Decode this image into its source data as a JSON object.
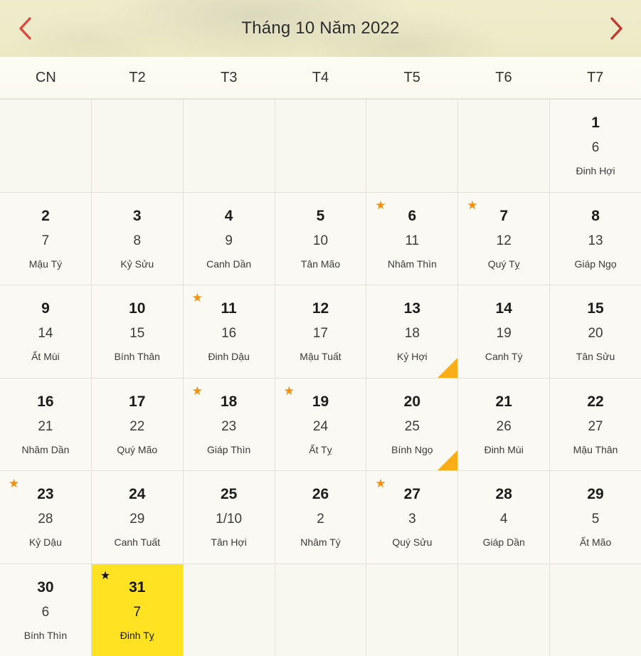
{
  "header": {
    "title": "Tháng 10 Năm 2022",
    "prev_label": "‹",
    "next_label": "›",
    "prev_icon": "chevron-left-icon",
    "next_icon": "chevron-right-icon",
    "accent_color": "#d94b42",
    "background_color": "#eeebc9"
  },
  "weekdays": [
    "CN",
    "T2",
    "T3",
    "T4",
    "T5",
    "T6",
    "T7"
  ],
  "legend": {
    "star_icon": "★",
    "star_color": "#f29011",
    "today_star_color": "#121212",
    "today_background": "#ffe323",
    "triangle_color": "#f9ad17"
  },
  "days": [
    {
      "solar": "",
      "lunar": "",
      "canchi": "",
      "blank": true
    },
    {
      "solar": "",
      "lunar": "",
      "canchi": "",
      "blank": true
    },
    {
      "solar": "",
      "lunar": "",
      "canchi": "",
      "blank": true
    },
    {
      "solar": "",
      "lunar": "",
      "canchi": "",
      "blank": true
    },
    {
      "solar": "",
      "lunar": "",
      "canchi": "",
      "blank": true
    },
    {
      "solar": "",
      "lunar": "",
      "canchi": "",
      "blank": true
    },
    {
      "solar": "1",
      "lunar": "6",
      "canchi": "Đinh Hợi"
    },
    {
      "solar": "2",
      "lunar": "7",
      "canchi": "Mậu Tý"
    },
    {
      "solar": "3",
      "lunar": "8",
      "canchi": "Kỷ Sửu"
    },
    {
      "solar": "4",
      "lunar": "9",
      "canchi": "Canh Dần"
    },
    {
      "solar": "5",
      "lunar": "10",
      "canchi": "Tân Mão"
    },
    {
      "solar": "6",
      "lunar": "11",
      "canchi": "Nhâm Thìn",
      "star": true
    },
    {
      "solar": "7",
      "lunar": "12",
      "canchi": "Quý Tỵ",
      "star": true
    },
    {
      "solar": "8",
      "lunar": "13",
      "canchi": "Giáp Ngọ"
    },
    {
      "solar": "9",
      "lunar": "14",
      "canchi": "Ất Mùi"
    },
    {
      "solar": "10",
      "lunar": "15",
      "canchi": "Bính Thân"
    },
    {
      "solar": "11",
      "lunar": "16",
      "canchi": "Đinh Dậu",
      "star": true
    },
    {
      "solar": "12",
      "lunar": "17",
      "canchi": "Mậu Tuất"
    },
    {
      "solar": "13",
      "lunar": "18",
      "canchi": "Kỷ Hợi",
      "triangle": true
    },
    {
      "solar": "14",
      "lunar": "19",
      "canchi": "Canh Tý"
    },
    {
      "solar": "15",
      "lunar": "20",
      "canchi": "Tân Sửu"
    },
    {
      "solar": "16",
      "lunar": "21",
      "canchi": "Nhâm Dần"
    },
    {
      "solar": "17",
      "lunar": "22",
      "canchi": "Quý Mão"
    },
    {
      "solar": "18",
      "lunar": "23",
      "canchi": "Giáp Thìn",
      "star": true
    },
    {
      "solar": "19",
      "lunar": "24",
      "canchi": "Ất Tỵ",
      "star": true
    },
    {
      "solar": "20",
      "lunar": "25",
      "canchi": "Bính Ngọ",
      "triangle": true
    },
    {
      "solar": "21",
      "lunar": "26",
      "canchi": "Đinh Mùi"
    },
    {
      "solar": "22",
      "lunar": "27",
      "canchi": "Mậu Thân"
    },
    {
      "solar": "23",
      "lunar": "28",
      "canchi": "Kỷ Dậu",
      "star": true
    },
    {
      "solar": "24",
      "lunar": "29",
      "canchi": "Canh Tuất"
    },
    {
      "solar": "25",
      "lunar": "1/10",
      "canchi": "Tân Hợi"
    },
    {
      "solar": "26",
      "lunar": "2",
      "canchi": "Nhâm Tý"
    },
    {
      "solar": "27",
      "lunar": "3",
      "canchi": "Quý Sửu",
      "star": true
    },
    {
      "solar": "28",
      "lunar": "4",
      "canchi": "Giáp Dần"
    },
    {
      "solar": "29",
      "lunar": "5",
      "canchi": "Ất Mão"
    },
    {
      "solar": "30",
      "lunar": "6",
      "canchi": "Bính Thìn"
    },
    {
      "solar": "31",
      "lunar": "7",
      "canchi": "Đinh Tỵ",
      "star": true,
      "today": true
    },
    {
      "solar": "",
      "lunar": "",
      "canchi": "",
      "blank": true
    },
    {
      "solar": "",
      "lunar": "",
      "canchi": "",
      "blank": true
    },
    {
      "solar": "",
      "lunar": "",
      "canchi": "",
      "blank": true
    },
    {
      "solar": "",
      "lunar": "",
      "canchi": "",
      "blank": true
    },
    {
      "solar": "",
      "lunar": "",
      "canchi": "",
      "blank": true
    }
  ]
}
